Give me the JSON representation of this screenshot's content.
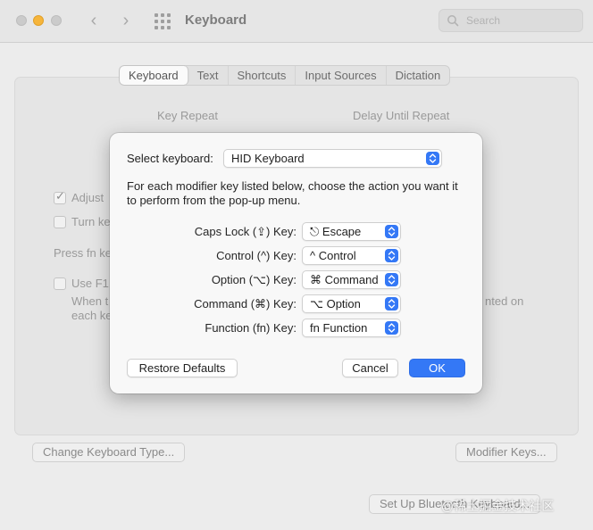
{
  "window": {
    "title": "Keyboard"
  },
  "search": {
    "placeholder": "Search"
  },
  "tabs": [
    {
      "label": "Keyboard",
      "active": true
    },
    {
      "label": "Text"
    },
    {
      "label": "Shortcuts"
    },
    {
      "label": "Input Sources"
    },
    {
      "label": "Dictation"
    }
  ],
  "background": {
    "key_repeat": "Key Repeat",
    "delay_until_repeat": "Delay Until Repeat",
    "adjust_partial": "Adjust",
    "turn_partial": "Turn ke",
    "press_fn_partial": "Press fn ke",
    "use_f1_partial": "Use F1,",
    "when_partial": "When t",
    "each_partial": "each ke",
    "nted_on": "nted on",
    "change_keyboard_type": "Change Keyboard Type...",
    "modifier_keys": "Modifier Keys...",
    "set_up_bluetooth": "Set Up Bluetooth Keyboard..."
  },
  "modal": {
    "select_keyboard_label": "Select keyboard:",
    "select_keyboard_value": "HID Keyboard",
    "description": "For each modifier key listed below, choose the action you want it to perform from the pop-up menu.",
    "rows": [
      {
        "label": "Caps Lock (⇪) Key:",
        "value": "⎋ Escape"
      },
      {
        "label": "Control (^) Key:",
        "value": "^ Control"
      },
      {
        "label": "Option (⌥) Key:",
        "value": "⌘ Command"
      },
      {
        "label": "Command (⌘) Key:",
        "value": "⌥ Option"
      },
      {
        "label": "Function (fn) Key:",
        "value": "fn Function"
      }
    ],
    "restore_defaults": "Restore Defaults",
    "cancel": "Cancel",
    "ok": "OK"
  },
  "watermark": "@稀土掘金技术社区",
  "colors": {
    "accent": "#3478f6",
    "minimize": "#f6b53b"
  }
}
